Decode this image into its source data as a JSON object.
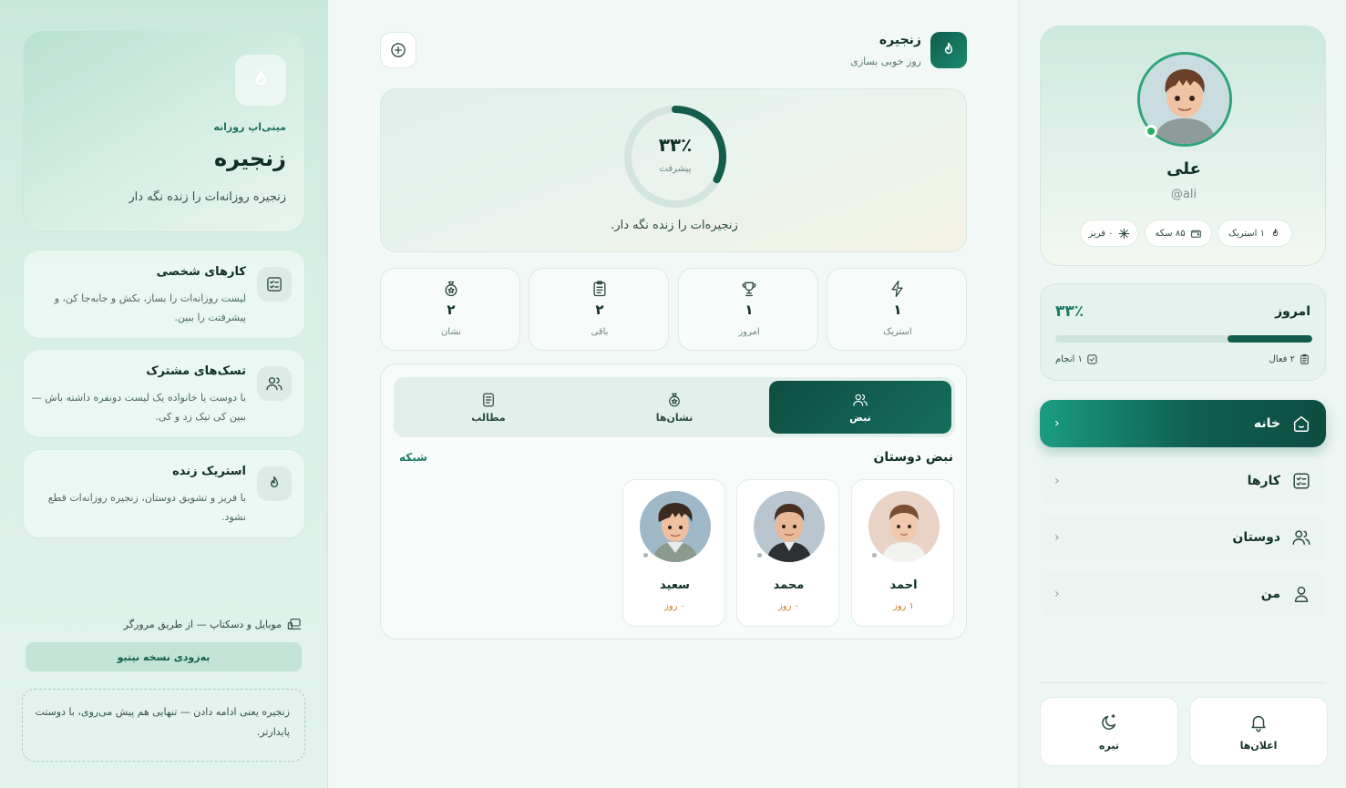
{
  "left": {
    "hero": {
      "kicker": "مینی‌اپ روزانه",
      "title": "زنجیره",
      "subtitle": "زنجیره روزانه‌ات را زنده نگه دار"
    },
    "features": [
      {
        "title": "کارهای شخصی",
        "desc": "لیست روزانه‌ات را بساز، بکش و جابه‌جا کن، و پیشرفتت را ببین.",
        "icon": "checklist-icon"
      },
      {
        "title": "تسک‌های مشترک",
        "desc": "با دوست یا خانواده یک لیست دونفره داشته باش — ببین کی تیک زد و کی.",
        "icon": "users-icon"
      },
      {
        "title": "استریک زنده",
        "desc": "با فریز و تشویق دوستان، زنجیره روزانه‌ات قطع نشود.",
        "icon": "flame-icon"
      }
    ],
    "platform": "موبایل و دسکتاپ — از طریق مرورگر",
    "native_button": "به‌زودی نسخه نیتیو",
    "quote": "زنجیره یعنی ادامه دادن — تنهایی هم پیش می‌روی، با دوستت پایدارتر."
  },
  "center": {
    "header": {
      "title": "زنجیره",
      "subtitle": "روز خوبی بسازی"
    },
    "progress": {
      "value_text": "۳۳٪",
      "fraction": 0.33,
      "label": "پیشرفت",
      "caption": "زنجیره‌ات را زنده نگه دار."
    },
    "stats": [
      {
        "value": "۱",
        "label": "استریک",
        "icon": "bolt-icon"
      },
      {
        "value": "۱",
        "label": "امروز",
        "icon": "trophy-icon"
      },
      {
        "value": "۲",
        "label": "باقی",
        "icon": "clipboard-icon"
      },
      {
        "value": "۲",
        "label": "نشان",
        "icon": "badge-icon"
      }
    ],
    "tabs": [
      {
        "label": "نبض",
        "icon": "users-icon",
        "active": true
      },
      {
        "label": "نشان‌ها",
        "icon": "badge-icon",
        "active": false
      },
      {
        "label": "مطالب",
        "icon": "document-icon",
        "active": false
      }
    ],
    "section_title": "نبض دوستان",
    "section_link": "شبکه",
    "friends": [
      {
        "name": "احمد",
        "streak": "۱ روز"
      },
      {
        "name": "محمد",
        "streak": "۰ روز"
      },
      {
        "name": "سعید",
        "streak": "۰ روز"
      }
    ]
  },
  "right": {
    "profile": {
      "name": "علی",
      "handle": "@ali",
      "chips": [
        {
          "text": "۱ استریک",
          "icon": "flame-icon"
        },
        {
          "text": "۸۵ سکه",
          "icon": "wallet-icon"
        },
        {
          "text": "۰ فریز",
          "icon": "snowflake-icon"
        }
      ]
    },
    "today": {
      "title": "امروز",
      "pct_text": "۳۳٪",
      "fraction": 0.33,
      "active_text": "۲ فعال",
      "done_text": "۱ انجام"
    },
    "nav": [
      {
        "label": "خانه",
        "icon": "home-icon",
        "active": true
      },
      {
        "label": "کارها",
        "icon": "checklist-icon",
        "active": false
      },
      {
        "label": "دوستان",
        "icon": "users-icon",
        "active": false
      },
      {
        "label": "من",
        "icon": "user-icon",
        "active": false
      }
    ],
    "bottom": {
      "notifications": "اعلان‌ها",
      "theme": "تیره"
    },
    "colors": {
      "accent": "#125d4c",
      "accent_light": "#1a9c80",
      "streak": "#c77a1e",
      "online": "#23b35f"
    }
  }
}
